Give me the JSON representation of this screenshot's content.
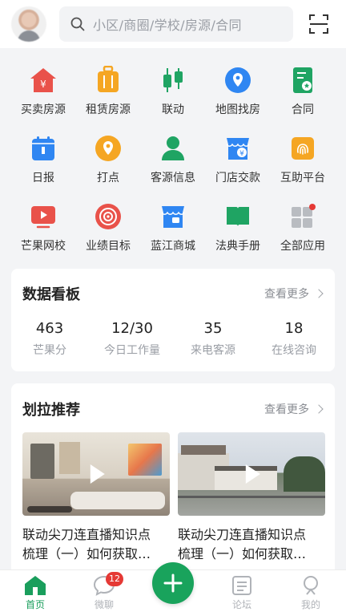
{
  "header": {
    "search_placeholder": "小区/商圈/学校/房源/合同"
  },
  "grid": [
    {
      "label": "买卖房源",
      "icon": "house-yen-icon",
      "color": "#e9524a"
    },
    {
      "label": "租赁房源",
      "icon": "suitcase-icon",
      "color": "#f5a623"
    },
    {
      "label": "联动",
      "icon": "candlestick-icon",
      "color": "#1fa463"
    },
    {
      "label": "地图找房",
      "icon": "map-pin-icon",
      "color": "#2f86f2"
    },
    {
      "label": "合同",
      "icon": "contract-icon",
      "color": "#1fa463"
    },
    {
      "label": "日报",
      "icon": "calendar-icon",
      "color": "#2f86f2"
    },
    {
      "label": "打点",
      "icon": "location-icon",
      "color": "#f5a623"
    },
    {
      "label": "客源信息",
      "icon": "person-icon",
      "color": "#1fa463"
    },
    {
      "label": "门店交款",
      "icon": "store-yen-icon",
      "color": "#2f86f2"
    },
    {
      "label": "互助平台",
      "icon": "fingerprint-icon",
      "color": "#f5a623"
    },
    {
      "label": "芒果网校",
      "icon": "video-play-icon",
      "color": "#e9524a"
    },
    {
      "label": "业绩目标",
      "icon": "target-icon",
      "color": "#e9524a"
    },
    {
      "label": "蓝江商城",
      "icon": "shop-icon",
      "color": "#2f86f2"
    },
    {
      "label": "法典手册",
      "icon": "book-icon",
      "color": "#1fa463"
    },
    {
      "label": "全部应用",
      "icon": "apps-grid-icon",
      "color": "#b9bcc1"
    }
  ],
  "dashboard": {
    "title": "数据看板",
    "more": "查看更多",
    "stats": [
      {
        "value": "463",
        "label": "芒果分"
      },
      {
        "value": "12/30",
        "label": "今日工作量"
      },
      {
        "value": "35",
        "label": "来电客源"
      },
      {
        "value": "18",
        "label": "在线咨询"
      }
    ]
  },
  "recommend": {
    "title": "划拉推荐",
    "more": "查看更多",
    "videos": [
      {
        "title_line1": "联动尖刀连直播知识点",
        "title_line2": "梳理（一）如何获取…"
      },
      {
        "title_line1": "联动尖刀连直播知识点",
        "title_line2": "梳理（一）如何获取…"
      }
    ]
  },
  "tabbar": {
    "tabs": [
      {
        "label": "首页",
        "icon": "home-icon"
      },
      {
        "label": "微聊",
        "icon": "chat-bubble-icon",
        "badge": "12"
      },
      {
        "label": "",
        "icon": "plus-icon"
      },
      {
        "label": "论坛",
        "icon": "forum-icon"
      },
      {
        "label": "我的",
        "icon": "profile-icon"
      }
    ],
    "active_color": "#1a9e5c"
  }
}
